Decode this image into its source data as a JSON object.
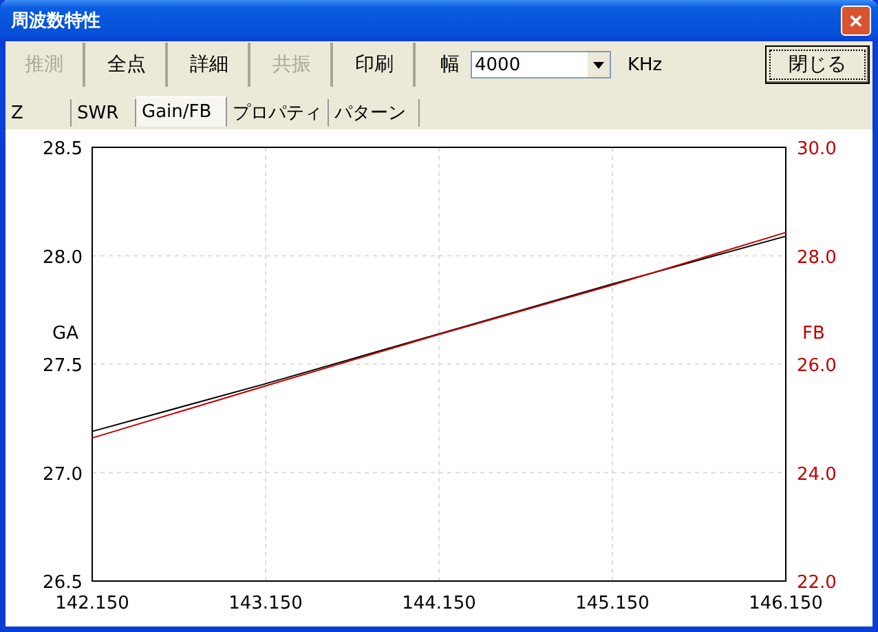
{
  "window": {
    "title": "周波数特性",
    "close_label": "✕"
  },
  "toolbar": {
    "buttons": [
      {
        "label": "推測",
        "disabled": true
      },
      {
        "label": "全点",
        "disabled": false
      },
      {
        "label": "詳細",
        "disabled": false
      },
      {
        "label": "共振",
        "disabled": true
      },
      {
        "label": "印刷",
        "disabled": false
      }
    ],
    "width_label": "幅",
    "width_value": "4000",
    "unit": "KHz",
    "close_button": {
      "label": "閉じる",
      "default": true
    }
  },
  "tabs": [
    {
      "label": "Z",
      "selected": false
    },
    {
      "label": "SWR",
      "selected": false
    },
    {
      "label": "Gain/FB",
      "selected": true
    },
    {
      "label": "プロパティ",
      "selected": false
    },
    {
      "label": "パターン",
      "selected": false
    }
  ],
  "chart_data": {
    "type": "line",
    "x": [
      142.15,
      143.15,
      144.15,
      145.15,
      146.15
    ],
    "series": [
      {
        "name": "GA",
        "color": "#000000",
        "values": [
          27.19,
          27.41,
          27.64,
          27.87,
          28.09
        ]
      },
      {
        "name": "FB",
        "color": "#c00000",
        "axis": "y2",
        "values": [
          24.64,
          25.6,
          26.55,
          27.46,
          28.43
        ]
      }
    ],
    "xlim": [
      142.15,
      146.15
    ],
    "ylim": [
      26.5,
      28.5
    ],
    "y2lim": [
      22,
      30
    ],
    "xticks": [
      {
        "value": 142.15,
        "label": "142.150"
      },
      {
        "value": 143.15,
        "label": "143.150"
      },
      {
        "value": 144.15,
        "label": "144.150"
      },
      {
        "value": 145.15,
        "label": "145.150"
      },
      {
        "value": 146.15,
        "label": "146.150"
      }
    ],
    "yticks": [
      {
        "value": 26.5,
        "label": "26.5"
      },
      {
        "value": 27,
        "label": "27.0"
      },
      {
        "value": 27.5,
        "label": "27.5"
      },
      {
        "value": 28,
        "label": "28.0"
      },
      {
        "value": 28.5,
        "label": "28.5"
      }
    ],
    "y2ticks": [
      {
        "value": 22,
        "label": "22.0"
      },
      {
        "value": 24,
        "label": "24.0"
      },
      {
        "value": 26,
        "label": "26.0"
      },
      {
        "value": 28,
        "label": "28.0"
      },
      {
        "value": 30,
        "label": "30.0"
      }
    ],
    "grid": true
  }
}
